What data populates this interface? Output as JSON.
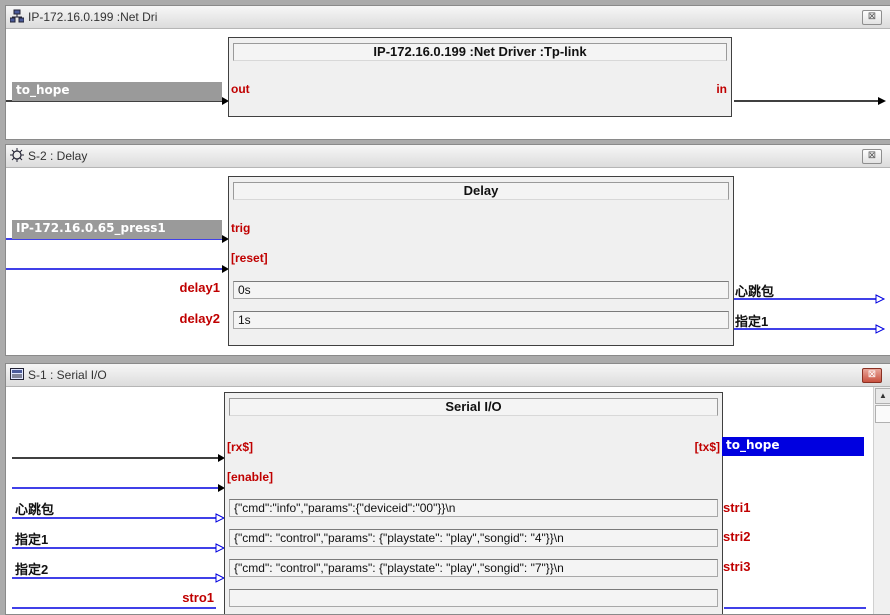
{
  "windows": [
    {
      "title": "IP-172.16.0.199 :Net Dri",
      "icon": "network-icon",
      "block": {
        "title": "IP-172.16.0.199 :Net Driver :Tp-link",
        "inputs": [
          "out"
        ],
        "outputs": [
          "in"
        ]
      },
      "input_signals": [
        "to_hope"
      ]
    },
    {
      "title": "S-2 : Delay",
      "icon": "delay-icon",
      "block": {
        "title": "Delay",
        "inputs": [
          "trig",
          "[reset]"
        ],
        "params": [
          "0s",
          "1s"
        ],
        "param_labels": [
          "delay1",
          "delay2"
        ]
      },
      "input_signals": [
        "IP-172.16.0.65_press1"
      ],
      "output_signals": [
        "心跳包",
        "指定1"
      ]
    },
    {
      "title": "S-1 : Serial I/O",
      "icon": "serial-icon",
      "block": {
        "title": "Serial I/O",
        "inputs": [
          "[rx$]",
          "[enable]"
        ],
        "outputs": [
          "[tx$]"
        ],
        "params": [
          "{\"cmd\":\"info\",\"params\":{\"deviceid\":\"00\"}}\\n",
          "{\"cmd\": \"control\",\"params\": {\"playstate\": \"play\",\"songid\": \"4\"}}\\n",
          "{\"cmd\": \"control\",\"params\": {\"playstate\": \"play\",\"songid\": \"7\"}}\\n",
          ""
        ],
        "param_outputs": [
          "stri1",
          "stri2",
          "stri3"
        ]
      },
      "input_signals": [
        "心跳包",
        "指定1",
        "指定2"
      ],
      "input_labels": [
        "stro1"
      ],
      "output_signals": [
        "to_hope"
      ]
    }
  ],
  "close_glyph": "⊠",
  "colors": {
    "pin": "#c00000",
    "wire_blue": "#0000e0",
    "wire_black": "#000000",
    "signal_grey": "#9a9a9a"
  }
}
